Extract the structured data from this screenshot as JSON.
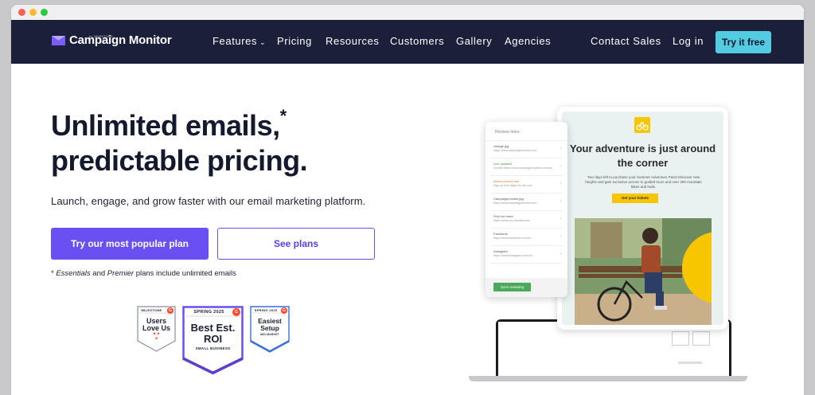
{
  "nav": {
    "brand": "Campaign Monitor",
    "brand_sub": "by MARIGOLD",
    "links": [
      "Features",
      "Pricing",
      "Resources",
      "Customers",
      "Gallery",
      "Agencies"
    ],
    "contact": "Contact Sales",
    "login": "Log in",
    "cta": "Try it free"
  },
  "hero": {
    "title_line1": "Unlimited emails,",
    "title_asterisk": "*",
    "title_line2": "predictable pricing.",
    "subtitle": "Launch, engage, and grow faster with our email marketing platform.",
    "primary_cta": "Try our most popular plan",
    "secondary_cta": "See plans",
    "note_prefix": "* ",
    "note_plan1": "Essentials",
    "note_and": " and ",
    "note_plan2": "Premier",
    "note_suffix": " plans include unlimited emails"
  },
  "badges": [
    {
      "top": "MILESTONE",
      "main": "Users Love Us"
    },
    {
      "top": "SPRING 2025",
      "main": "Best Est. ROI",
      "sub": "SMALL BUSINESS"
    },
    {
      "top": "SPRING 2025",
      "main": "Easiest Setup",
      "sub": "MID-MARKET"
    }
  ],
  "illustration": {
    "email_title": "Your adventure is just around the corner",
    "email_body": "Two days left to purchase your Summer Adventure Pass! Discover new heights and gain exclusive access to guided tours and over 300 mountain bikes and trails.",
    "email_button": "Get your tickets",
    "panel_title": "Review links",
    "panel_items": [
      {
        "title": "vintage.jpg",
        "url": "https://www.campaignmonitor.com"
      },
      {
        "title": "Link updated",
        "url": "Donate https://www.campaignmonitor.com/don"
      },
      {
        "title": "Broken button link",
        "url": "Sign up now https://ex.ctrl.com"
      },
      {
        "title": "Campaignmonitor.jpg",
        "url": "https://www.campaignmonitor.com"
      },
      {
        "title": "Find out more",
        "url": "https://www.cm.com/aboutus"
      },
      {
        "title": "Facebook",
        "url": "https://www.facebook.com/cm"
      },
      {
        "title": "Instagram",
        "url": "https://www.instagram.com/cm"
      }
    ],
    "panel_button": "Done reviewing"
  },
  "colors": {
    "nav_bg": "#1b1f3a",
    "accent": "#6a4ff3",
    "cta_cyan": "#53cbe0",
    "yellow": "#f7c600"
  }
}
